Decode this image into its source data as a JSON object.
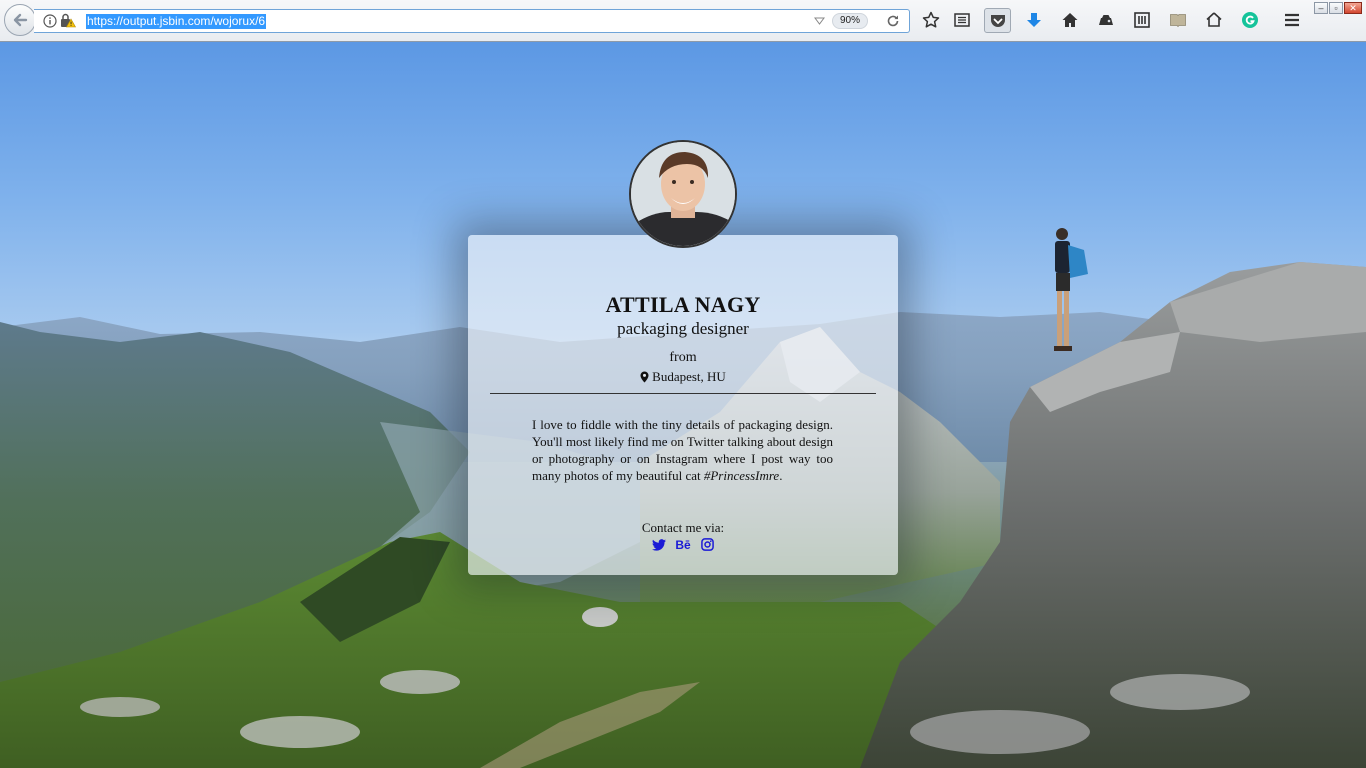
{
  "browser": {
    "url": "https://output.jsbin.com/wojorux/6",
    "zoom": "90%",
    "icons": [
      "back-arrow-icon",
      "info-icon",
      "insecure-lock-icon",
      "dropmarker-icon",
      "reload-icon",
      "bookmark-star-icon",
      "reader-list-icon",
      "pocket-icon",
      "download-icon",
      "home-icon",
      "synced-tabs-icon",
      "library-icon",
      "reading-mode-icon",
      "home-outline-icon",
      "grammarly-icon",
      "hamburger-menu-icon"
    ]
  },
  "profile": {
    "name": "ATTILA NAGY",
    "job": "packaging designer",
    "from_label": "from",
    "location": "Budapest, HU",
    "bio_text": "I love to fiddle with the tiny details of packaging design. You'll most likely find me on Twitter talking about design or photography or on Instagram where I post way too many photos of my beautiful cat ",
    "bio_tag": "#PrincessImre",
    "bio_end": ".",
    "contact_label": "Contact me via:",
    "social_behance_label": "Bē",
    "icons": [
      "map-marker-icon",
      "twitter-icon",
      "behance-icon",
      "instagram-icon"
    ],
    "accent_color": "#1b1bd6"
  }
}
